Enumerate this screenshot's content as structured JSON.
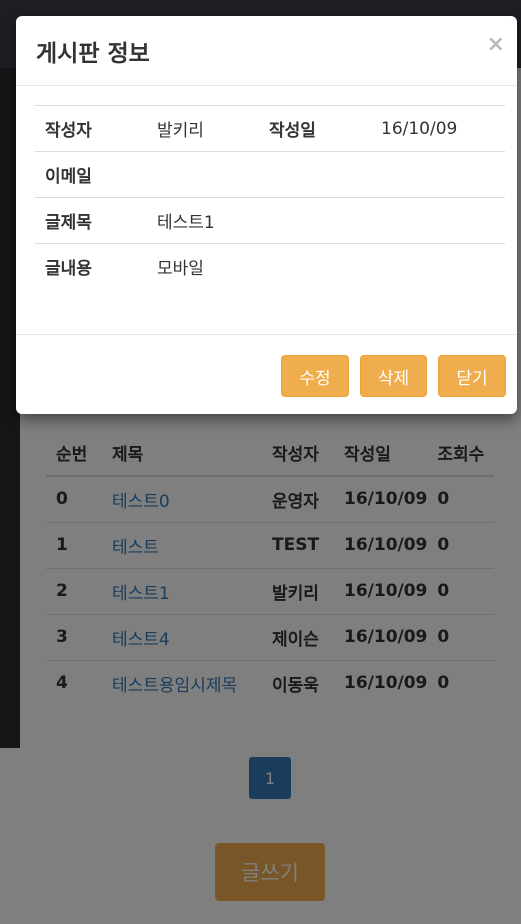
{
  "modal": {
    "title": "게시판 정보",
    "close_glyph": "×",
    "rows": [
      {
        "label": "작성자",
        "value": "발키리",
        "label2": "작성일",
        "value2": "16/10/09"
      },
      {
        "label": "이메일",
        "value": "",
        "label2": "",
        "value2": ""
      },
      {
        "label": "글제목",
        "value": "테스트1",
        "label2": "",
        "value2": ""
      },
      {
        "label": "글내용",
        "value": "모바일",
        "label2": "",
        "value2": ""
      }
    ],
    "buttons": {
      "edit": "수정",
      "delete": "삭제",
      "close": "닫기"
    }
  },
  "board": {
    "headers": [
      "순번",
      "제목",
      "작성자",
      "작성일",
      "조회수"
    ],
    "rows": [
      {
        "num": "0",
        "title": "테스트0",
        "author": "운영자",
        "date": "16/10/09",
        "views": "0"
      },
      {
        "num": "1",
        "title": "테스트",
        "author": "TEST",
        "date": "16/10/09",
        "views": "0"
      },
      {
        "num": "2",
        "title": "테스트1",
        "author": "발키리",
        "date": "16/10/09",
        "views": "0"
      },
      {
        "num": "3",
        "title": "테스트4",
        "author": "제이슨",
        "date": "16/10/09",
        "views": "0"
      },
      {
        "num": "4",
        "title": "테스트용임시제목",
        "author": "이동욱",
        "date": "16/10/09",
        "views": "0"
      }
    ]
  },
  "pagination": {
    "current": "1"
  },
  "write_button": "글쓰기",
  "colors": {
    "accent": "#f0ad4e",
    "primary": "#337ab7",
    "backdrop": "rgba(0,0,0,0.5)"
  }
}
